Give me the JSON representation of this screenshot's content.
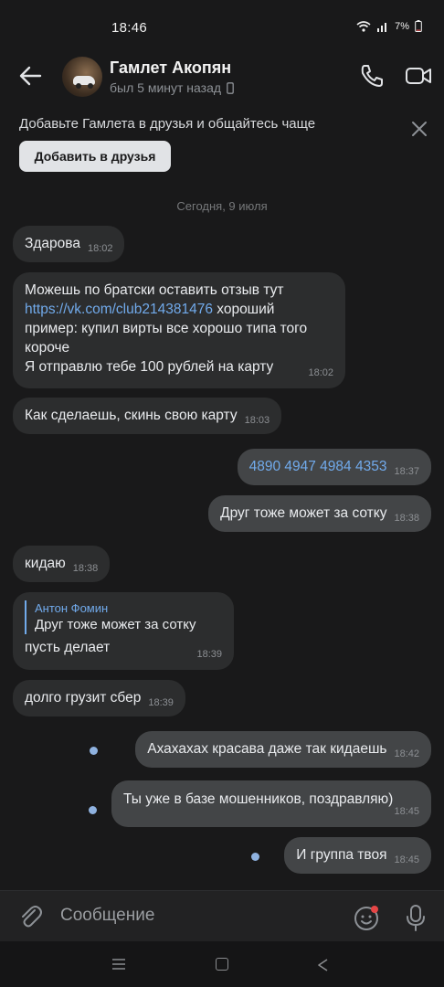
{
  "status_bar": {
    "time": "18:46",
    "battery": "7%"
  },
  "header": {
    "name": "Гамлет Акопян",
    "status": "был 5 минут назад"
  },
  "banner": {
    "text": "Добавьте Гамлета в друзья и общайтесь чаще",
    "button": "Добавить в друзья"
  },
  "date_separator": "Сегодня, 9 июля",
  "messages": [
    {
      "dir": "in",
      "text": "Здарова",
      "time": "18:02"
    },
    {
      "dir": "in",
      "lines": [
        "Можешь по братски оставить отзыв тут",
        "хороший",
        "пример: купил вирты все хорошо типа того",
        "короче",
        "Я отправлю тебе 100 рублей на карту"
      ],
      "link": "https://vk.com/club214381476",
      "time": "18:02"
    },
    {
      "dir": "in",
      "text": "Как сделаешь, скинь свою карту",
      "time": "18:03"
    },
    {
      "dir": "out",
      "text": "4890 4947 4984 4353",
      "time": "18:37"
    },
    {
      "dir": "out",
      "text": "Друг тоже может за сотку",
      "time": "18:38"
    },
    {
      "dir": "in",
      "text": "кидаю",
      "time": "18:38"
    },
    {
      "dir": "in",
      "reply_author": "Антон Фомин",
      "reply_text": "Друг тоже может за сотку",
      "text": "пусть делает",
      "time": "18:39"
    },
    {
      "dir": "in",
      "text": "долго грузит сбер",
      "time": "18:39"
    },
    {
      "dir": "out",
      "text": "Ахахахах красава даже так кидаешь",
      "time": "18:42",
      "unread": true
    },
    {
      "dir": "out",
      "text": "Ты уже в базе мошенников, поздравляю)",
      "time": "18:45",
      "unread": true
    },
    {
      "dir": "out",
      "text": "И группа твоя",
      "time": "18:45",
      "unread": true
    }
  ],
  "composer": {
    "placeholder": "Сообщение"
  },
  "colors": {
    "background": "#19191a",
    "incoming": "#2c2d2e",
    "outgoing": "#434547",
    "accent": "#71aaeb"
  }
}
